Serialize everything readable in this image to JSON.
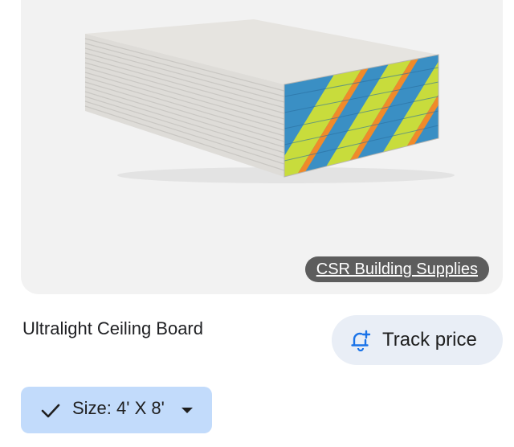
{
  "product": {
    "title": "Ultralight Ceiling Board",
    "image_alt": "stack of plasterboard sheets",
    "source": "CSR Building Supplies"
  },
  "actions": {
    "track_price_label": "Track price",
    "track_price_icon": "bell-plus-icon"
  },
  "size_chip": {
    "label": "Size: 4' X 8'",
    "check_icon": "checkmark-icon",
    "dropdown_icon": "caret-down-icon"
  },
  "colors": {
    "card_bg": "#f2f2f2",
    "track_price_bg": "#e9eef6",
    "track_price_icon": "#1a73e8",
    "size_chip_bg": "#c2dbfb"
  }
}
